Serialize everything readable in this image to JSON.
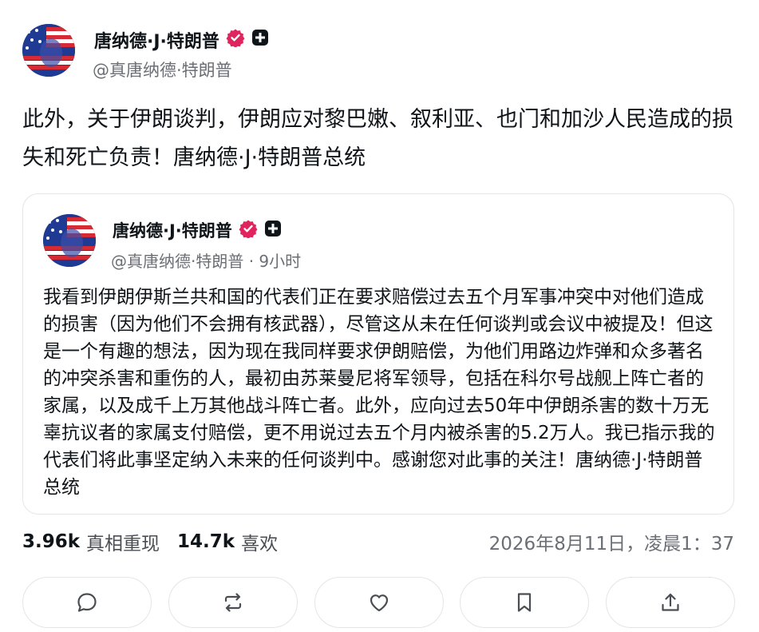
{
  "post": {
    "author_name": "唐纳德·J·特朗普",
    "handle": "@真唐纳德·特朗普",
    "text": "此外，关于伊朗谈判，伊朗应对黎巴嫩、叙利亚、也门和加沙人民造成的损失和死亡负责！唐纳德·J·特朗普总统"
  },
  "quoted": {
    "author_name": "唐纳德·J·特朗普",
    "handle_time": "@真唐纳德·特朗普 · 9小时",
    "text": "我看到伊朗伊斯兰共和国的代表们正在要求赔偿过去五个月军事冲突中对他们造成的损害（因为他们不会拥有核武器），尽管这从未在任何谈判或会议中被提及！但这是一个有趣的想法，因为现在我同样要求伊朗赔偿，为他们用路边炸弹和众多著名的冲突杀害和重伤的人，最初由苏莱曼尼将军领导，包括在科尔号战舰上阵亡者的家属，以及成千上万其他战斗阵亡者。此外，应向过去50年中伊朗杀害的数十万无辜抗议者的家属支付赔偿，更不用说过去五个月内被杀害的5.2万人。我已指示我的代表们将此事坚定纳入未来的任何谈判中。感谢您对此事的关注！唐纳德·J·特朗普总统"
  },
  "stats": {
    "retruths_count": "3.96k",
    "retruths_label": "真相重现",
    "likes_count": "14.7k",
    "likes_label": "喜欢",
    "timestamp": "2026年8月11日，凌晨1：37"
  },
  "icons": {
    "verified": "verified-badge-icon",
    "plus": "plus-badge-icon",
    "reply": "reply-icon",
    "repost": "repost-icon",
    "like": "heart-icon",
    "bookmark": "bookmark-icon",
    "share": "share-icon"
  },
  "colors": {
    "verified_badge": "#e0245e",
    "text_primary": "#0f1419",
    "text_secondary": "#6b6f75",
    "border": "#e3e5e8"
  }
}
